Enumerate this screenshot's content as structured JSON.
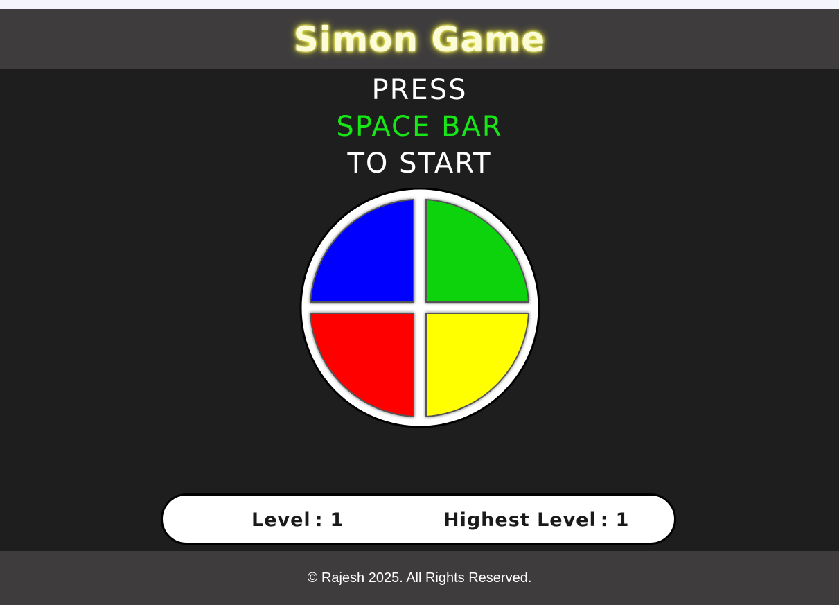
{
  "header": {
    "title": "Simon Game"
  },
  "prompt": {
    "line1": "PRESS",
    "line2": "SPACE BAR",
    "line3": "TO START"
  },
  "board": {
    "pads": [
      {
        "name": "blue",
        "color": "#0000ff"
      },
      {
        "name": "green",
        "color": "#0fd30f"
      },
      {
        "name": "red",
        "color": "#ff0000"
      },
      {
        "name": "yellow",
        "color": "#ffff00"
      }
    ]
  },
  "status": {
    "level_label": "Level",
    "level_value": "1",
    "highest_label": "Highest Level",
    "highest_value": "1",
    "separator": ":"
  },
  "footer": {
    "text": "© Rajesh 2025. All Rights Reserved."
  },
  "colors": {
    "prompt_accent": "#17e617",
    "title_glow": "#e8e850",
    "header_bg": "#3e3c3d",
    "page_bg": "#1e1e1e"
  }
}
